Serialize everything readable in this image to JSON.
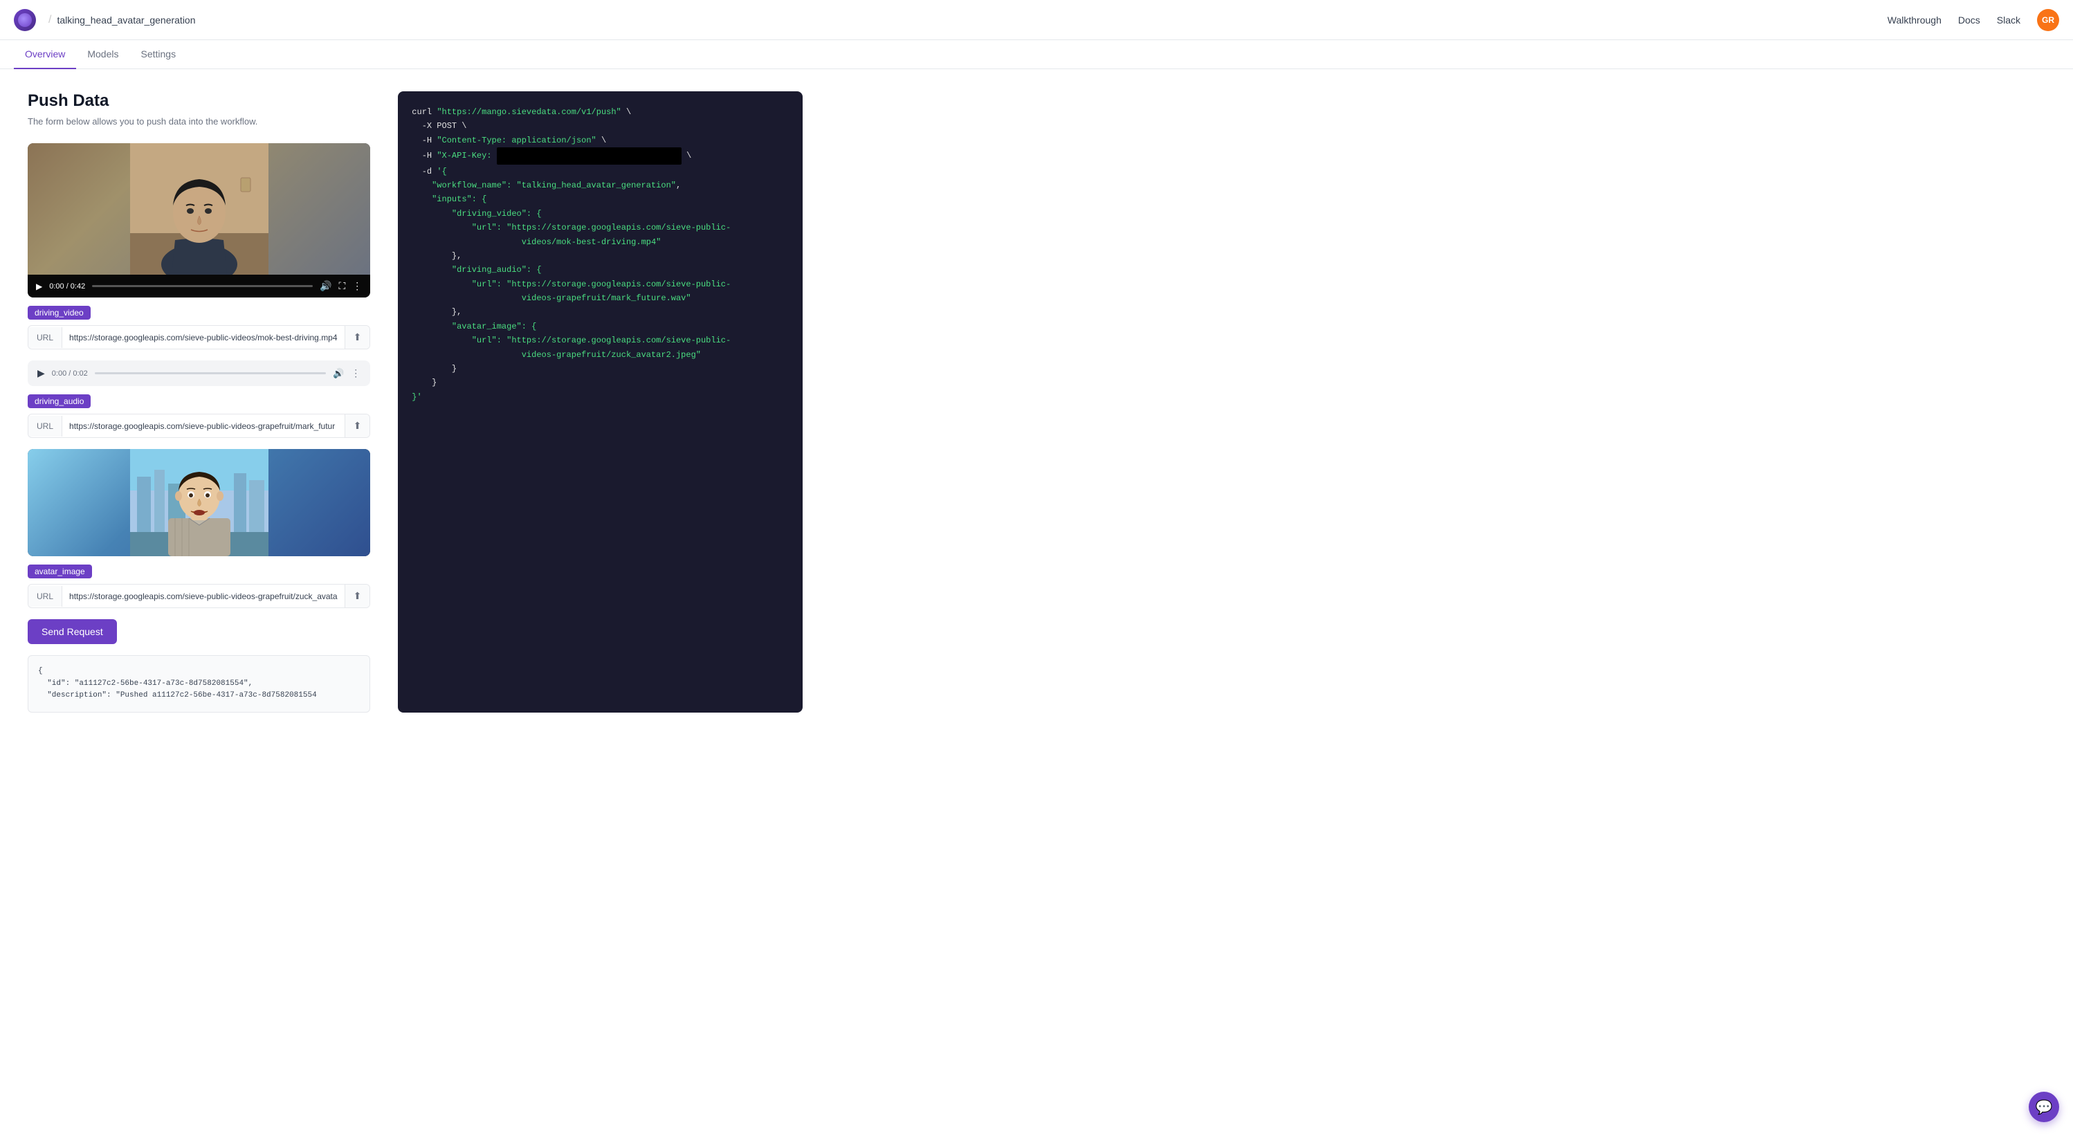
{
  "header": {
    "logo_alt": "Sieve logo",
    "divider": "/",
    "project_name": "talking_head_avatar_generation",
    "nav": {
      "walkthrough": "Walkthrough",
      "docs": "Docs",
      "slack": "Slack",
      "avatar_initials": "GR"
    }
  },
  "tabs": [
    {
      "label": "Overview",
      "active": true
    },
    {
      "label": "Models",
      "active": false
    },
    {
      "label": "Settings",
      "active": false
    }
  ],
  "main": {
    "title": "Push Data",
    "subtitle": "The form below allows you to push data into the workflow.",
    "inputs": [
      {
        "badge": "driving_video",
        "url_label": "URL",
        "url_value": "https://storage.googleapis.com/sieve-public-videos/mok-best-driving.mp4",
        "video_time": "0:00 / 0:42",
        "has_video": true
      },
      {
        "badge": "driving_audio",
        "url_label": "URL",
        "url_value": "https://storage.googleapis.com/sieve-public-videos-grapefruit/mark_futur",
        "audio_time": "0:00 / 0:02",
        "has_audio": true
      },
      {
        "badge": "avatar_image",
        "url_label": "URL",
        "url_value": "https://storage.googleapis.com/sieve-public-videos-grapefruit/zuck_avata",
        "has_image": true
      }
    ],
    "send_button": "Send Request",
    "response_preview": "{\n  \"id\": \"a11127c2-56be-4317-a73c-8d7582081554\",\n  \"description\": \"Pushed a11127c2-56be-4317-a73c-8d7582081554"
  },
  "code_panel": {
    "lines": [
      {
        "type": "command",
        "text": "curl \"https://mango.sievedata.com/v1/push\" \\"
      },
      {
        "type": "flag",
        "text": "  -X POST \\"
      },
      {
        "type": "flag",
        "text": "  -H \"Content-Type: application/json\" \\"
      },
      {
        "type": "flag-key",
        "text": "  -H \"X-API-Key: ",
        "redacted": true,
        "suffix": " \\"
      },
      {
        "type": "flag",
        "text": "  -d '{"
      },
      {
        "type": "json",
        "text": "    \"workflow_name\": \"talking_head_avatar_generation\","
      },
      {
        "type": "json",
        "text": "    \"inputs\": {"
      },
      {
        "type": "json",
        "text": "        \"driving_video\": {"
      },
      {
        "type": "json-url",
        "text": "            \"url\": \"https://storage.googleapis.com/sieve-public-videos/mok-best-driving.mp4\""
      },
      {
        "type": "json",
        "text": "        },"
      },
      {
        "type": "json",
        "text": "        \"driving_audio\": {"
      },
      {
        "type": "json-url",
        "text": "            \"url\": \"https://storage.googleapis.com/sieve-public-videos-grapefruit/mark_future.wav\""
      },
      {
        "type": "json",
        "text": "        },"
      },
      {
        "type": "json",
        "text": "        \"avatar_image\": {"
      },
      {
        "type": "json-url",
        "text": "            \"url\": \"https://storage.googleapis.com/sieve-public-videos-grapefruit/zuck_avatar2.jpeg\""
      },
      {
        "type": "json",
        "text": "        }"
      },
      {
        "type": "json",
        "text": "    }"
      },
      {
        "type": "flag",
        "text": "}'"
      }
    ]
  }
}
